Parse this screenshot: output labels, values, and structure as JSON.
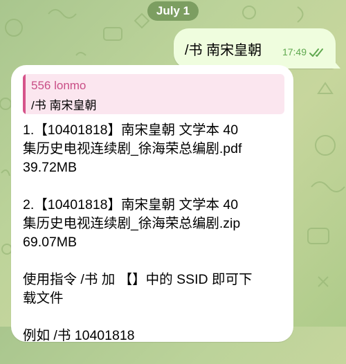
{
  "date_divider": "July 1",
  "outgoing": {
    "text": "/书 南宋皇朝",
    "time": "17:49",
    "status_icon": "double-check-icon"
  },
  "incoming": {
    "reply": {
      "author": "556 lonmo",
      "quoted_text": "/书 南宋皇朝"
    },
    "paragraphs": [
      "1.【10401818】南宋皇朝  文学本  40\n集历史电视连续剧_徐海荣总编剧.pdf\n39.72MB",
      "2.【10401818】南宋皇朝  文学本  40\n集历史电视连续剧_徐海荣总编剧.zip\n69.07MB",
      "使用指令 /书 加 【】中的 SSID 即可下\n载文件",
      "例如 /书 10401818"
    ]
  },
  "colors": {
    "outgoing_bubble": "#effdde",
    "incoming_bubble": "#ffffff",
    "reply_accent": "#d6548b",
    "time_green": "#5fa84f"
  }
}
